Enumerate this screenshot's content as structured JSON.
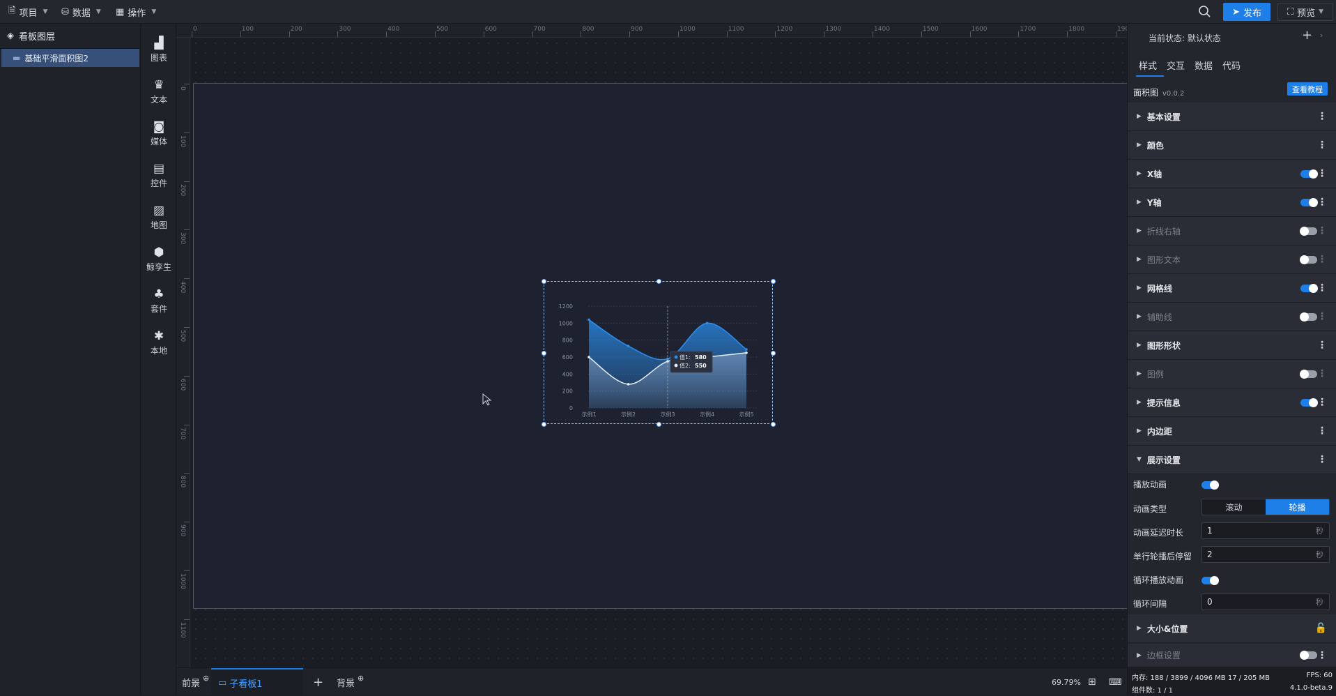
{
  "topbar": {
    "menus": [
      {
        "label": "项目",
        "icon": "file-icon"
      },
      {
        "label": "数据",
        "icon": "database-icon"
      },
      {
        "label": "操作",
        "icon": "grid-icon"
      }
    ],
    "publish_label": "发布",
    "preview_label": "预览"
  },
  "layers": {
    "title": "看板图层",
    "items": [
      {
        "label": "基础平滑面积图2"
      }
    ]
  },
  "toolbox": {
    "items": [
      {
        "label": "图表",
        "icon": "bar-chart-icon"
      },
      {
        "label": "文本",
        "icon": "crown-icon"
      },
      {
        "label": "媒体",
        "icon": "media-icon"
      },
      {
        "label": "控件",
        "icon": "widget-icon"
      },
      {
        "label": "地图",
        "icon": "map-icon"
      },
      {
        "label": "鲸孪生",
        "icon": "cube-icon"
      },
      {
        "label": "套件",
        "icon": "shirt-icon"
      },
      {
        "label": "本地",
        "icon": "puzzle-icon"
      }
    ]
  },
  "rulers": {
    "horizontal": [
      "0",
      "100",
      "200",
      "300",
      "400",
      "500",
      "600",
      "700",
      "800",
      "900",
      "1000",
      "1100",
      "1200",
      "1300",
      "1400",
      "1500",
      "1600",
      "1700",
      "1800",
      "1900"
    ],
    "vertical": [
      "0",
      "100",
      "200",
      "300",
      "400",
      "500",
      "600",
      "700",
      "800",
      "900",
      "1000",
      "1100"
    ]
  },
  "chart_data": {
    "type": "area",
    "categories": [
      "示例1",
      "示例2",
      "示例3",
      "示例4",
      "示例5"
    ],
    "series": [
      {
        "name": "值1",
        "values": [
          1040,
          730,
          580,
          1000,
          690
        ]
      },
      {
        "name": "值2",
        "values": [
          600,
          280,
          550,
          600,
          650
        ]
      }
    ],
    "ylim": [
      0,
      1200
    ],
    "yticks": [
      "0",
      "200",
      "400",
      "600",
      "800",
      "1000",
      "1200"
    ],
    "grid": true,
    "tooltip": {
      "category": "示例3",
      "rows": [
        {
          "name": "值1",
          "value": "580"
        },
        {
          "name": "值2",
          "value": "550"
        }
      ]
    },
    "colors": {
      "series1": "#2a8ff0",
      "series2": "#e6eef8"
    }
  },
  "bottombar": {
    "tab_front": "前景",
    "tab_board": "子看板1",
    "tab_background": "背景",
    "zoom": "69.79%"
  },
  "rpanel": {
    "state_label": "当前状态:",
    "state_value": "默认状态",
    "tabs": [
      "样式",
      "交互",
      "数据",
      "代码"
    ],
    "component_name": "面积图",
    "component_version": "v0.0.2",
    "tutorial_label": "查看教程",
    "sections": [
      {
        "label": "基本设置",
        "toggle": null,
        "dim": false
      },
      {
        "label": "颜色",
        "toggle": null,
        "dim": false
      },
      {
        "label": "X轴",
        "toggle": "on",
        "dim": false
      },
      {
        "label": "Y轴",
        "toggle": "on",
        "dim": false
      },
      {
        "label": "折线右轴",
        "toggle": "off",
        "dim": true
      },
      {
        "label": "图形文本",
        "toggle": "off",
        "dim": true
      },
      {
        "label": "网格线",
        "toggle": "on",
        "dim": false
      },
      {
        "label": "辅助线",
        "toggle": "off",
        "dim": true
      },
      {
        "label": "图形形状",
        "toggle": null,
        "dim": false
      },
      {
        "label": "图例",
        "toggle": "off",
        "dim": true
      },
      {
        "label": "提示信息",
        "toggle": "on",
        "dim": false
      },
      {
        "label": "内边距",
        "toggle": null,
        "dim": false
      },
      {
        "label": "展示设置",
        "toggle": null,
        "dim": false,
        "expanded": true
      }
    ],
    "display": {
      "play_animation_label": "播放动画",
      "animation_type_label": "动画类型",
      "animation_type_options": [
        "滚动",
        "轮播"
      ],
      "animation_type_selected": "轮播",
      "delay_label": "动画延迟时长",
      "delay_value": "1",
      "stay_label": "单行轮播后停留",
      "stay_value": "2",
      "loop_label": "循环播放动画",
      "interval_label": "循环间隔",
      "interval_value": "0",
      "unit": "秒"
    },
    "size_position_label": "大小&位置",
    "border_label": "边框设置",
    "status": {
      "memory": "内存:  188 / 3899 / 4096 MB  17 / 205 MB",
      "fps": "FPS:  60",
      "components": "组件数: 1 / 1",
      "version": "4.1.0-beta.9"
    }
  }
}
